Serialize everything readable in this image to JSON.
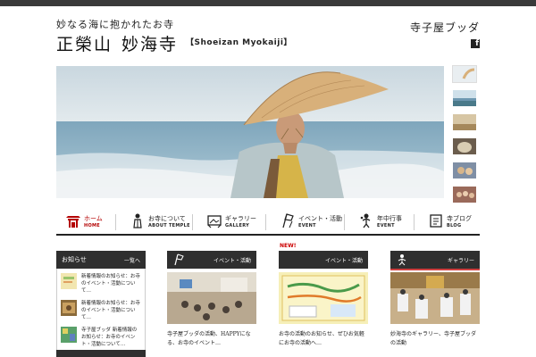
{
  "header": {
    "tagline": "妙なる海に抱かれたお寺",
    "title_left": "正榮山",
    "title_right": "妙海寺",
    "subtitle": "【Shoeizan Myokaiji】",
    "blog_link": "寺子屋ブッダ",
    "facebook_letter": "f"
  },
  "hero": {
    "thumbnails": [
      "thumb-1",
      "thumb-2",
      "thumb-3",
      "thumb-4",
      "thumb-5",
      "thumb-6"
    ]
  },
  "nav": {
    "items": [
      {
        "jp": "ホーム",
        "en": "HOME",
        "icon": "temple-gate-icon"
      },
      {
        "jp": "お寺について",
        "en": "ABOUT TEMPLE",
        "icon": "monk-icon"
      },
      {
        "jp": "ギャラリー",
        "en": "GALLERY",
        "icon": "picture-frame-icon"
      },
      {
        "jp": "イベント・活動",
        "en": "EVENT",
        "icon": "flag-icon"
      },
      {
        "jp": "年中行事",
        "en": "EVENT",
        "icon": "person-icon"
      },
      {
        "jp": "寺ブログ",
        "en": "BLOG",
        "icon": "notebook-icon"
      }
    ]
  },
  "news": {
    "head_left": "お知らせ",
    "head_right": "一覧へ",
    "items": [
      "新着情報のお知らせ：お寺のイベント・活動について…",
      "新着情報のお知らせ：お寺のイベント・活動について…",
      "寺子屋ブッダ 新着情報のお知らせ：お寺のイベント・活動について…"
    ]
  },
  "cards": [
    {
      "head": "イベント・活動",
      "caption": "寺子屋ブッダの活動、HAPPYになる、お寺のイベント…",
      "badge": ""
    },
    {
      "head": "イベント・活動",
      "caption": "お寺の活動のお知らせ、ぜひお気軽にお寺の活動へ…",
      "badge": "NEW!"
    },
    {
      "head": "ギャラリー",
      "caption": "妙海寺のギャラリー、寺子屋ブッダの活動",
      "badge": ""
    }
  ],
  "colors": {
    "accent": "#b40000",
    "dark_bar": "#2f2f2f",
    "sea": "#8fb3c7",
    "hat": "#d8b07a"
  }
}
